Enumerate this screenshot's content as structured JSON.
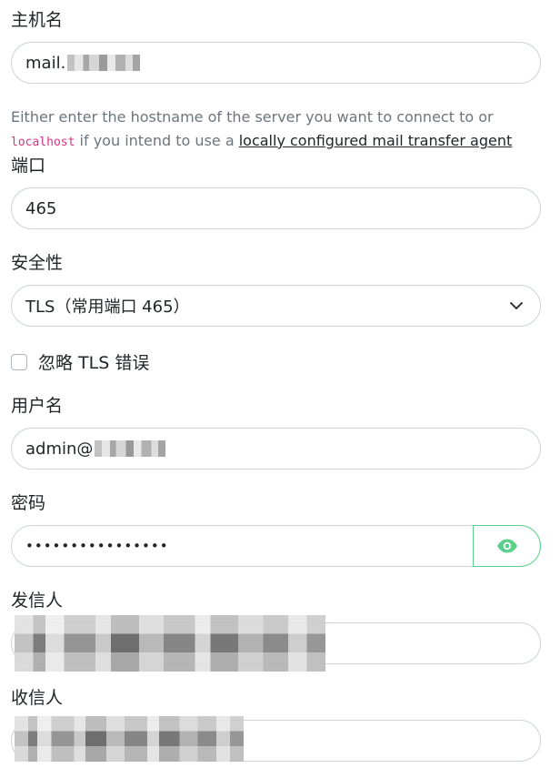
{
  "form": {
    "hostname": {
      "label": "主机名",
      "value": "mail."
    },
    "help": {
      "part1": "Either enter the hostname of the server you want to connect to or ",
      "code": "localhost",
      "part2": " if you intend to use a ",
      "link": "locally configured mail transfer agent"
    },
    "port": {
      "label": "端口",
      "value": "465"
    },
    "security": {
      "label": "安全性",
      "value": "TLS（常用端口 465）"
    },
    "ignore_tls": {
      "label": "忽略 TLS 错误"
    },
    "username": {
      "label": "用户名",
      "value": "admin@"
    },
    "password": {
      "label": "密码",
      "value": "••••••••••••••••"
    },
    "sender": {
      "label": "发信人"
    },
    "recipient": {
      "label": "收信人"
    }
  },
  "colors": {
    "accent": "#5cd08d",
    "code": "#d63384",
    "help_text": "#6c757d",
    "border": "#ced4da"
  },
  "icons": {
    "security_select": "chevron-down-icon",
    "password_toggle": "eye-icon"
  }
}
